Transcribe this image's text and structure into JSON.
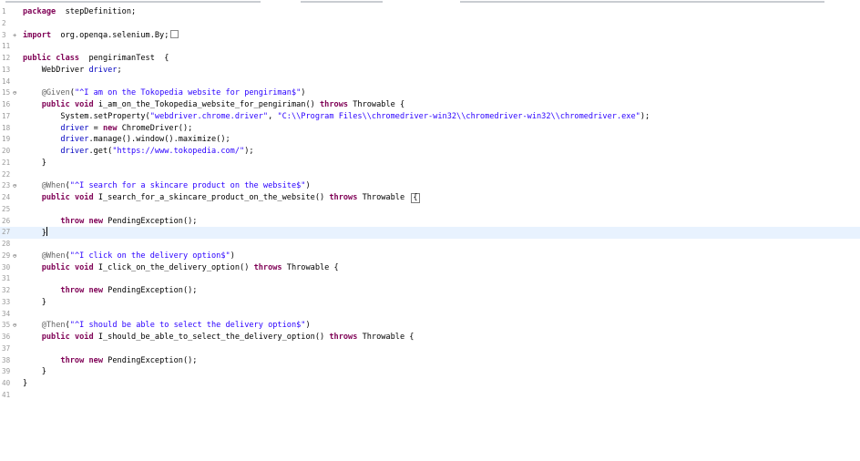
{
  "code_lines": [
    {
      "num": "1",
      "fold": "",
      "parts": [
        [
          "kw",
          "package"
        ],
        [
          "",
          "  stepDefinition;"
        ]
      ]
    },
    {
      "num": "2",
      "fold": "",
      "parts": []
    },
    {
      "num": "3",
      "fold": "+",
      "parts": [
        [
          "kw",
          "import"
        ],
        [
          "",
          "  org.openqa.selenium.By;"
        ]
      ],
      "collapsed": true
    },
    {
      "num": "11",
      "fold": "",
      "parts": []
    },
    {
      "num": "12",
      "fold": "",
      "parts": [
        [
          "kw",
          "public"
        ],
        [
          "",
          " "
        ],
        [
          "kw",
          "class"
        ],
        [
          "",
          "  pengirimanTest  {"
        ]
      ]
    },
    {
      "num": "13",
      "fold": "",
      "parts": [
        [
          "",
          "    WebDriver "
        ],
        [
          "fld",
          "driver"
        ],
        [
          "",
          ";"
        ]
      ]
    },
    {
      "num": "14",
      "fold": "",
      "parts": []
    },
    {
      "num": "15",
      "fold": "⊖",
      "parts": [
        [
          "",
          "    "
        ],
        [
          "ann",
          "@Given"
        ],
        [
          "",
          "("
        ],
        [
          "str",
          "\"^I am on the Tokopedia website for pengiriman$\""
        ],
        [
          "",
          ")"
        ]
      ]
    },
    {
      "num": "16",
      "fold": "",
      "parts": [
        [
          "",
          "    "
        ],
        [
          "kw",
          "public"
        ],
        [
          "",
          " "
        ],
        [
          "kw",
          "void"
        ],
        [
          "",
          " i_am_on_the_Tokopedia_website_for_pengiriman() "
        ],
        [
          "kw",
          "throws"
        ],
        [
          "",
          " Throwable {"
        ]
      ]
    },
    {
      "num": "17",
      "fold": "",
      "parts": [
        [
          "",
          "        System."
        ],
        [
          "",
          "setProperty"
        ],
        [
          "",
          "("
        ],
        [
          "str",
          "\"webdriver.chrome.driver\""
        ],
        [
          "",
          ", "
        ],
        [
          "str",
          "\"C:\\\\Program Files\\\\chromedriver-win32\\\\chromedriver-win32\\\\chromedriver.exe\""
        ],
        [
          "",
          ");"
        ]
      ]
    },
    {
      "num": "18",
      "fold": "",
      "parts": [
        [
          "",
          "        "
        ],
        [
          "fld",
          "driver"
        ],
        [
          "",
          " = "
        ],
        [
          "kw",
          "new"
        ],
        [
          "",
          " ChromeDriver();"
        ]
      ]
    },
    {
      "num": "19",
      "fold": "",
      "parts": [
        [
          "",
          "        "
        ],
        [
          "fld",
          "driver"
        ],
        [
          "",
          ".manage().window().maximize();"
        ]
      ]
    },
    {
      "num": "20",
      "fold": "",
      "parts": [
        [
          "",
          "        "
        ],
        [
          "fld",
          "driver"
        ],
        [
          "",
          ".get("
        ],
        [
          "str",
          "\"https://www.tokopedia.com/\""
        ],
        [
          "",
          ");"
        ]
      ]
    },
    {
      "num": "21",
      "fold": "",
      "parts": [
        [
          "",
          "    }"
        ]
      ]
    },
    {
      "num": "22",
      "fold": "",
      "parts": []
    },
    {
      "num": "23",
      "fold": "⊖",
      "parts": [
        [
          "",
          "    "
        ],
        [
          "ann",
          "@When"
        ],
        [
          "",
          "("
        ],
        [
          "str",
          "\"^I search for a skincare product on the website$\""
        ],
        [
          "",
          ")"
        ]
      ]
    },
    {
      "num": "24",
      "fold": "",
      "parts": [
        [
          "",
          "    "
        ],
        [
          "kw",
          "public"
        ],
        [
          "",
          " "
        ],
        [
          "kw",
          "void"
        ],
        [
          "",
          " I_search_for_a_skincare_product_on_the_website() "
        ],
        [
          "kw",
          "throws"
        ],
        [
          "",
          " Throwable "
        ]
      ],
      "box": true
    },
    {
      "num": "25",
      "fold": "",
      "parts": []
    },
    {
      "num": "26",
      "fold": "",
      "parts": [
        [
          "",
          "        "
        ],
        [
          "kw",
          "throw"
        ],
        [
          "",
          " "
        ],
        [
          "kw",
          "new"
        ],
        [
          "",
          " PendingException();"
        ]
      ]
    },
    {
      "num": "27",
      "fold": "",
      "parts": [
        [
          "",
          "    }"
        ]
      ],
      "current": true
    },
    {
      "num": "28",
      "fold": "",
      "parts": []
    },
    {
      "num": "29",
      "fold": "⊖",
      "parts": [
        [
          "",
          "    "
        ],
        [
          "ann",
          "@When"
        ],
        [
          "",
          "("
        ],
        [
          "str",
          "\"^I click on the delivery option$\""
        ],
        [
          "",
          ")"
        ]
      ]
    },
    {
      "num": "30",
      "fold": "",
      "parts": [
        [
          "",
          "    "
        ],
        [
          "kw",
          "public"
        ],
        [
          "",
          " "
        ],
        [
          "kw",
          "void"
        ],
        [
          "",
          " I_click_on_the_delivery_option() "
        ],
        [
          "kw",
          "throws"
        ],
        [
          "",
          " Throwable {"
        ]
      ]
    },
    {
      "num": "31",
      "fold": "",
      "parts": []
    },
    {
      "num": "32",
      "fold": "",
      "parts": [
        [
          "",
          "        "
        ],
        [
          "kw",
          "throw"
        ],
        [
          "",
          " "
        ],
        [
          "kw",
          "new"
        ],
        [
          "",
          " PendingException();"
        ]
      ]
    },
    {
      "num": "33",
      "fold": "",
      "parts": [
        [
          "",
          "    }"
        ]
      ]
    },
    {
      "num": "34",
      "fold": "",
      "parts": []
    },
    {
      "num": "35",
      "fold": "⊖",
      "parts": [
        [
          "",
          "    "
        ],
        [
          "ann",
          "@Then"
        ],
        [
          "",
          "("
        ],
        [
          "str",
          "\"^I should be able to select the delivery option$\""
        ],
        [
          "",
          ")"
        ]
      ]
    },
    {
      "num": "36",
      "fold": "",
      "parts": [
        [
          "",
          "    "
        ],
        [
          "kw",
          "public"
        ],
        [
          "",
          " "
        ],
        [
          "kw",
          "void"
        ],
        [
          "",
          " I_should_be_able_to_select_the_delivery_option() "
        ],
        [
          "kw",
          "throws"
        ],
        [
          "",
          " Throwable {"
        ]
      ]
    },
    {
      "num": "37",
      "fold": "",
      "parts": []
    },
    {
      "num": "38",
      "fold": "",
      "parts": [
        [
          "",
          "        "
        ],
        [
          "kw",
          "throw"
        ],
        [
          "",
          " "
        ],
        [
          "kw",
          "new"
        ],
        [
          "",
          " PendingException();"
        ]
      ]
    },
    {
      "num": "39",
      "fold": "",
      "parts": [
        [
          "",
          "    }"
        ]
      ]
    },
    {
      "num": "40",
      "fold": "",
      "parts": [
        [
          "",
          "}"
        ]
      ]
    },
    {
      "num": "41",
      "fold": "",
      "parts": []
    }
  ]
}
